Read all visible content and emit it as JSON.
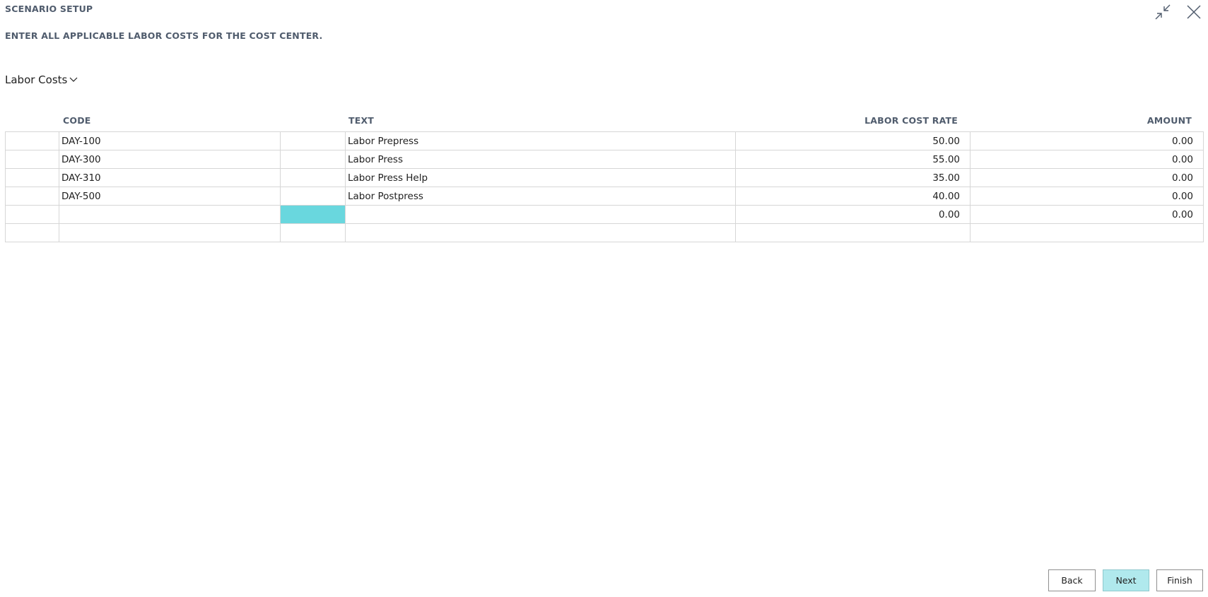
{
  "header": {
    "title": "SCENARIO SETUP",
    "subtitle": "ENTER ALL APPLICABLE LABOR COSTS FOR THE COST CENTER."
  },
  "window_controls": {
    "collapse_icon": "collapse-arrows-icon",
    "close_icon": "close-icon"
  },
  "section": {
    "label": "Labor Costs",
    "icon": "chevron-down-icon"
  },
  "table": {
    "columns": [
      "CODE",
      "TEXT",
      "LABOR COST RATE",
      "AMOUNT"
    ],
    "rows": [
      {
        "code": "DAY-100",
        "text": "Labor Prepress",
        "rate": "50.00",
        "amount": "0.00"
      },
      {
        "code": "DAY-300",
        "text": "Labor Press",
        "rate": "55.00",
        "amount": "0.00"
      },
      {
        "code": "DAY-310",
        "text": "Labor Press Help",
        "rate": "35.00",
        "amount": "0.00"
      },
      {
        "code": "DAY-500",
        "text": "Labor Postpress",
        "rate": "40.00",
        "amount": "0.00"
      },
      {
        "code": "",
        "text": "",
        "rate": "0.00",
        "amount": "0.00"
      },
      {
        "code": "",
        "text": "",
        "rate": "",
        "amount": ""
      }
    ]
  },
  "footer": {
    "back_label": "Back",
    "next_label": "Next",
    "finish_label": "Finish"
  },
  "colors": {
    "accent": "#69d7de",
    "primary_button": "#b0e9ed",
    "label_text": "#505c6d"
  }
}
